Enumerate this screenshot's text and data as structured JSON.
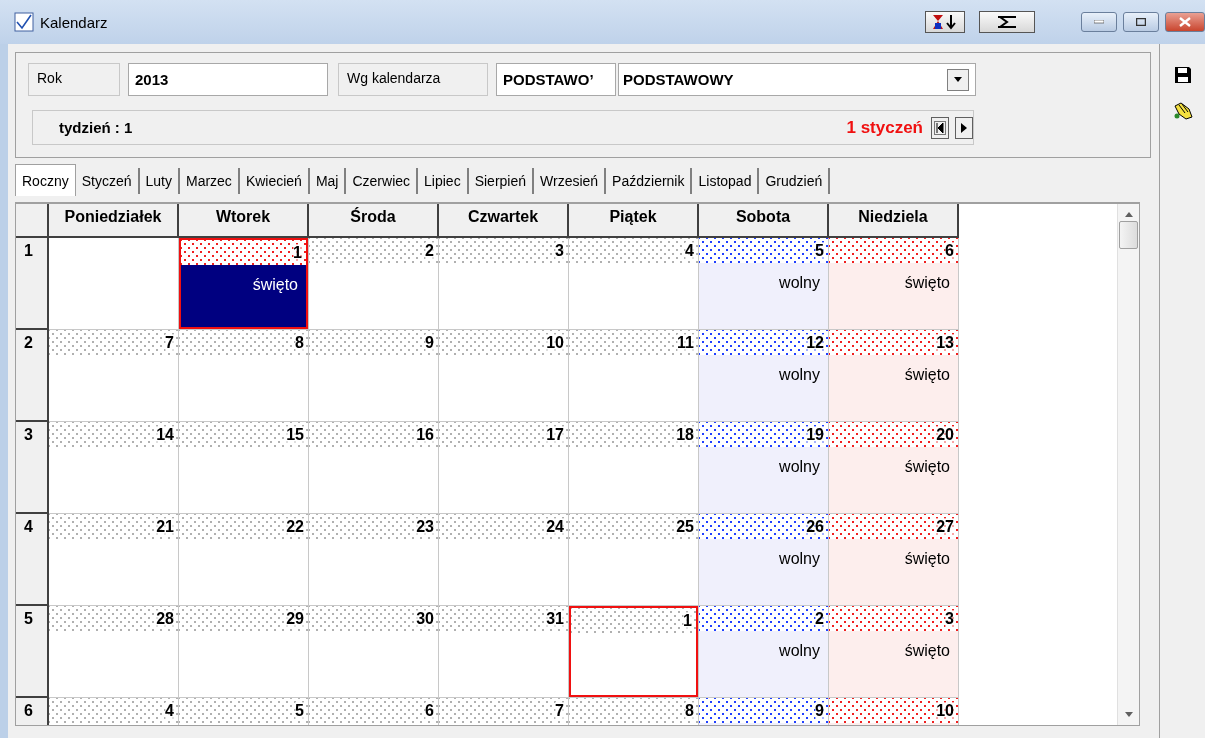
{
  "window": {
    "title": "Kalendarz"
  },
  "form": {
    "year_label": "Rok",
    "year": "2013",
    "calendar_label": "Wg kalendarza",
    "calendar_code": "PODSTAWOʼ",
    "calendar_name": "PODSTAWOWY",
    "week": "tydzień : 1",
    "date": "1 styczeń"
  },
  "tabs": [
    {
      "label": "Roczny",
      "selected": true
    },
    {
      "label": "Styczeń",
      "selected": false
    },
    {
      "label": "Luty",
      "selected": false
    },
    {
      "label": "Marzec",
      "selected": false
    },
    {
      "label": "Kwiecień",
      "selected": false
    },
    {
      "label": "Maj",
      "selected": false
    },
    {
      "label": "Czerwiec",
      "selected": false
    },
    {
      "label": "Lipiec",
      "selected": false
    },
    {
      "label": "Sierpień",
      "selected": false
    },
    {
      "label": "Wrzesień",
      "selected": false
    },
    {
      "label": "Październik",
      "selected": false
    },
    {
      "label": "Listopad",
      "selected": false
    },
    {
      "label": "Grudzień",
      "selected": false
    }
  ],
  "columns": [
    "Poniedziałek",
    "Wtorek",
    "Środa",
    "Czwartek",
    "Piątek",
    "Sobota",
    "Niedziela"
  ],
  "weeks": [
    {
      "number": "1",
      "days": [
        {
          "kind": "empty"
        },
        {
          "day": "1",
          "kind": "holiday",
          "note": "święto",
          "selected": true,
          "outlined": true
        },
        {
          "day": "2",
          "kind": "workday",
          "selected": false,
          "outlined": false
        },
        {
          "day": "3",
          "kind": "workday",
          "selected": false,
          "outlined": false
        },
        {
          "day": "4",
          "kind": "workday",
          "selected": false,
          "outlined": false
        },
        {
          "day": "5",
          "kind": "saturday",
          "note": "wolny",
          "selected": false,
          "outlined": false
        },
        {
          "day": "6",
          "kind": "holiday",
          "note": "święto",
          "selected": false,
          "outlined": false
        }
      ]
    },
    {
      "number": "2",
      "days": [
        {
          "day": "7",
          "kind": "workday",
          "selected": false,
          "outlined": false
        },
        {
          "day": "8",
          "kind": "workday",
          "selected": false,
          "outlined": false
        },
        {
          "day": "9",
          "kind": "workday",
          "selected": false,
          "outlined": false
        },
        {
          "day": "10",
          "kind": "workday",
          "selected": false,
          "outlined": false
        },
        {
          "day": "11",
          "kind": "workday",
          "selected": false,
          "outlined": false
        },
        {
          "day": "12",
          "kind": "saturday",
          "note": "wolny",
          "selected": false,
          "outlined": false
        },
        {
          "day": "13",
          "kind": "holiday",
          "note": "święto",
          "selected": false,
          "outlined": false
        }
      ]
    },
    {
      "number": "3",
      "days": [
        {
          "day": "14",
          "kind": "workday",
          "selected": false,
          "outlined": false
        },
        {
          "day": "15",
          "kind": "workday",
          "selected": false,
          "outlined": false
        },
        {
          "day": "16",
          "kind": "workday",
          "selected": false,
          "outlined": false
        },
        {
          "day": "17",
          "kind": "workday",
          "selected": false,
          "outlined": false
        },
        {
          "day": "18",
          "kind": "workday",
          "selected": false,
          "outlined": false
        },
        {
          "day": "19",
          "kind": "saturday",
          "note": "wolny",
          "selected": false,
          "outlined": false
        },
        {
          "day": "20",
          "kind": "holiday",
          "note": "święto",
          "selected": false,
          "outlined": false
        }
      ]
    },
    {
      "number": "4",
      "days": [
        {
          "day": "21",
          "kind": "workday",
          "selected": false,
          "outlined": false
        },
        {
          "day": "22",
          "kind": "workday",
          "selected": false,
          "outlined": false
        },
        {
          "day": "23",
          "kind": "workday",
          "selected": false,
          "outlined": false
        },
        {
          "day": "24",
          "kind": "workday",
          "selected": false,
          "outlined": false
        },
        {
          "day": "25",
          "kind": "workday",
          "selected": false,
          "outlined": false
        },
        {
          "day": "26",
          "kind": "saturday",
          "note": "wolny",
          "selected": false,
          "outlined": false
        },
        {
          "day": "27",
          "kind": "holiday",
          "note": "święto",
          "selected": false,
          "outlined": false
        }
      ]
    },
    {
      "number": "5",
      "days": [
        {
          "day": "28",
          "kind": "workday",
          "selected": false,
          "outlined": false
        },
        {
          "day": "29",
          "kind": "workday",
          "selected": false,
          "outlined": false
        },
        {
          "day": "30",
          "kind": "workday",
          "selected": false,
          "outlined": false
        },
        {
          "day": "31",
          "kind": "workday",
          "selected": false,
          "outlined": false
        },
        {
          "day": "1",
          "kind": "workday",
          "selected": false,
          "outlined": true
        },
        {
          "day": "2",
          "kind": "saturday",
          "note": "wolny",
          "selected": false,
          "outlined": false
        },
        {
          "day": "3",
          "kind": "holiday",
          "note": "święto",
          "selected": false,
          "outlined": false
        }
      ]
    },
    {
      "number": "6",
      "days": [
        {
          "day": "4",
          "kind": "workday",
          "selected": false,
          "outlined": false
        },
        {
          "day": "5",
          "kind": "workday",
          "selected": false,
          "outlined": false
        },
        {
          "day": "6",
          "kind": "workday",
          "selected": false,
          "outlined": false
        },
        {
          "day": "7",
          "kind": "workday",
          "selected": false,
          "outlined": false
        },
        {
          "day": "8",
          "kind": "workday",
          "selected": false,
          "outlined": false
        },
        {
          "day": "9",
          "kind": "saturday",
          "selected": false,
          "outlined": false
        },
        {
          "day": "10",
          "kind": "holiday",
          "selected": false,
          "outlined": false
        }
      ]
    }
  ]
}
